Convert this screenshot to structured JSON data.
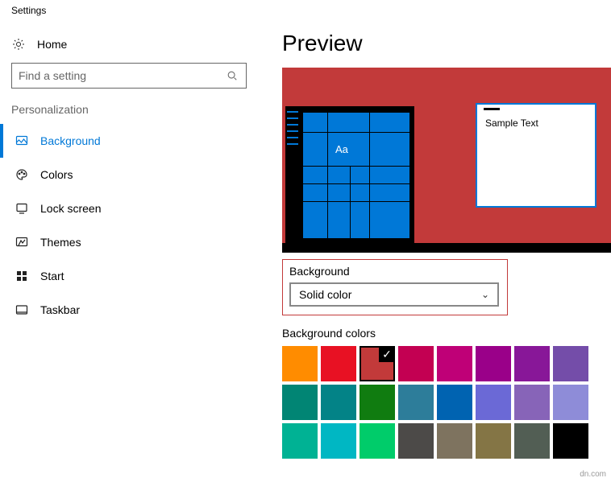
{
  "window": {
    "title": "Settings"
  },
  "home": {
    "label": "Home"
  },
  "search": {
    "placeholder": "Find a setting"
  },
  "section": {
    "label": "Personalization"
  },
  "nav": {
    "items": [
      {
        "label": "Background",
        "active": true
      },
      {
        "label": "Colors"
      },
      {
        "label": "Lock screen"
      },
      {
        "label": "Themes"
      },
      {
        "label": "Start"
      },
      {
        "label": "Taskbar"
      }
    ]
  },
  "main": {
    "heading": "Preview",
    "preview": {
      "window_text": "Sample Text",
      "tile_text": "Aa",
      "background_color": "#c23a3a"
    },
    "dropdown": {
      "label": "Background",
      "value": "Solid color"
    },
    "swatch_label": "Background colors",
    "swatch_rows": [
      [
        "#ff8c00",
        "#e81123",
        "#c23a3a",
        "#c30052",
        "#bf0077",
        "#9a0089",
        "#881798",
        "#744da9"
      ],
      [
        "#018574",
        "#038387",
        "#107c10",
        "#2d7d9a",
        "#0063b1",
        "#6b69d6",
        "#8764b8",
        "#8e8cd8"
      ],
      [
        "#00b294",
        "#00b7c3",
        "#00cc6a",
        "#4c4a48",
        "#7e735f",
        "#847545",
        "#525e54",
        "#000000"
      ]
    ],
    "selected_swatch": "#c23a3a"
  },
  "watermark": "dn.com"
}
